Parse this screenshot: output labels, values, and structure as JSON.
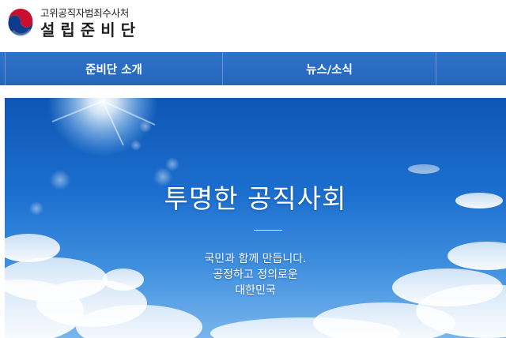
{
  "header": {
    "logo_icon": "taegeuk-emblem-icon",
    "org_name_line1": "고위공직자범죄수사처",
    "org_name_line2": "설립준비단"
  },
  "nav": {
    "items": [
      {
        "label": "준비단 소개"
      },
      {
        "label": "뉴스/소식"
      },
      {
        "label": ""
      }
    ],
    "background_color": "#2a6cc2"
  },
  "hero": {
    "title": "투명한 공직사회",
    "lines": [
      "국민과 함께 만듭니다.",
      "공정하고 정의로운",
      "대한민국"
    ],
    "sky_color": "#1c6fcf"
  }
}
